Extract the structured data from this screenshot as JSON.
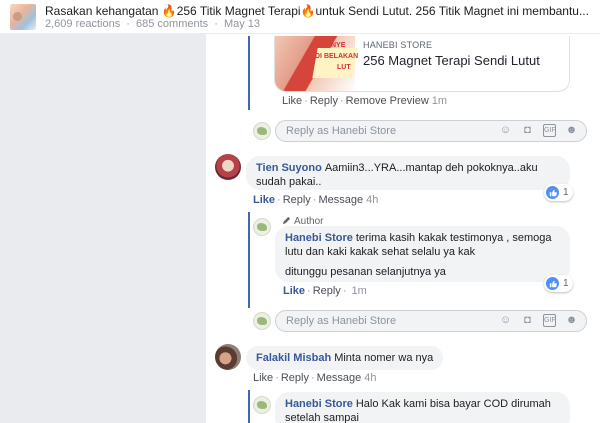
{
  "post": {
    "title": "Rasakan kehangatan 🔥256 Titik Magnet Terapi🔥untuk Sendi Lutut. 256 Titik Magnet ini membantu...",
    "reactions": "2,609 reactions",
    "dot": "·",
    "comments": "685 comments",
    "date": "May 13"
  },
  "preview": {
    "site": "HANEBI STORE",
    "title": "256 Magnet Terapi Sendi Lutut",
    "image_text": [
      "NYE",
      "DI BELAKAN",
      "LUT"
    ]
  },
  "actions": {
    "like": "Like",
    "reply": "Reply",
    "remove_preview": "Remove Preview",
    "message": "Message",
    "sep": "·"
  },
  "reply_placeholder": "Reply as Hanebi Store",
  "comments": [
    {
      "author": "Tien Suyono",
      "text": "Aamiin3...YRA...mantap deh pokoknya..aku sudah pakai..",
      "time": "4h",
      "reactions": "1"
    },
    {
      "author": "Falakil Misbah",
      "text": "Minta nomer wa nya",
      "time": "4h"
    }
  ],
  "replies": [
    {
      "time": "1m"
    },
    {
      "tag": "Author",
      "author": "Hanebi Store",
      "text1": "terima kasih kakak testimonya , semoga lutu dan kaki kakak sehat selalu ya kak",
      "text2": "ditunggu pesanan selanjutnya ya",
      "time": "1m",
      "reactions": "1"
    },
    {
      "author": "Hanebi Store",
      "text1": "Halo Kak kami bisa bayar COD dirumah setelah sampai"
    }
  ],
  "icons": [
    "emoji-icon",
    "camera-icon",
    "gif-icon",
    "sticker-icon"
  ],
  "colors": {
    "link": "#385898",
    "thread": "#4267b2",
    "like": "#4f8ff7"
  }
}
